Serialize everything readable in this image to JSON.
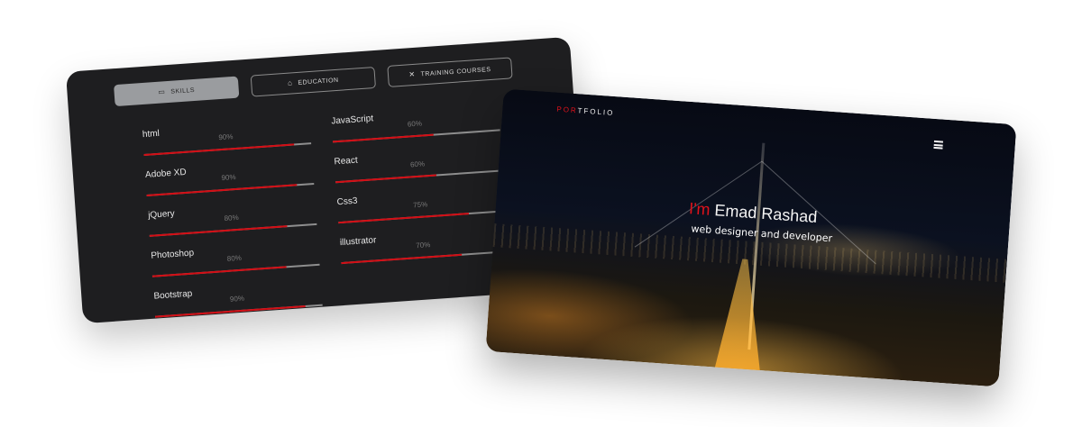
{
  "skills_panel": {
    "tabs": [
      {
        "label": "SKILLS",
        "icon": "monitor-icon",
        "active": true
      },
      {
        "label": "EDUCATION",
        "icon": "graduation-cap-icon",
        "active": false
      },
      {
        "label": "TRAINING COURSES",
        "icon": "tools-icon",
        "active": false
      }
    ],
    "skills": [
      {
        "name": "html",
        "percent_label": "90%",
        "level": 0.9
      },
      {
        "name": "Adobe XD",
        "percent_label": "90%",
        "level": 0.9
      },
      {
        "name": "jQuery",
        "percent_label": "80%",
        "level": 0.82
      },
      {
        "name": "Photoshop",
        "percent_label": "80%",
        "level": 0.8
      },
      {
        "name": "Bootstrap",
        "percent_label": "90%",
        "level": 0.9
      },
      {
        "name": "JavaScript",
        "percent_label": "60%",
        "level": 0.6
      },
      {
        "name": "React",
        "percent_label": "60%",
        "level": 0.6
      },
      {
        "name": "Css3",
        "percent_label": "75%",
        "level": 0.78
      },
      {
        "name": "illustrator",
        "percent_label": "70%",
        "level": 0.72
      }
    ]
  },
  "hero": {
    "logo_prefix": "POR",
    "logo_rest": "TFOLIO",
    "menu_icon": "hamburger-menu-icon",
    "greeting": "I'm",
    "name": "Emad Rashad",
    "subtitle": "web designer and developer"
  },
  "colors": {
    "accent": "#e0121b",
    "panel_bg": "#1e1e20",
    "tab_active_bg": "#9a9c9f"
  }
}
